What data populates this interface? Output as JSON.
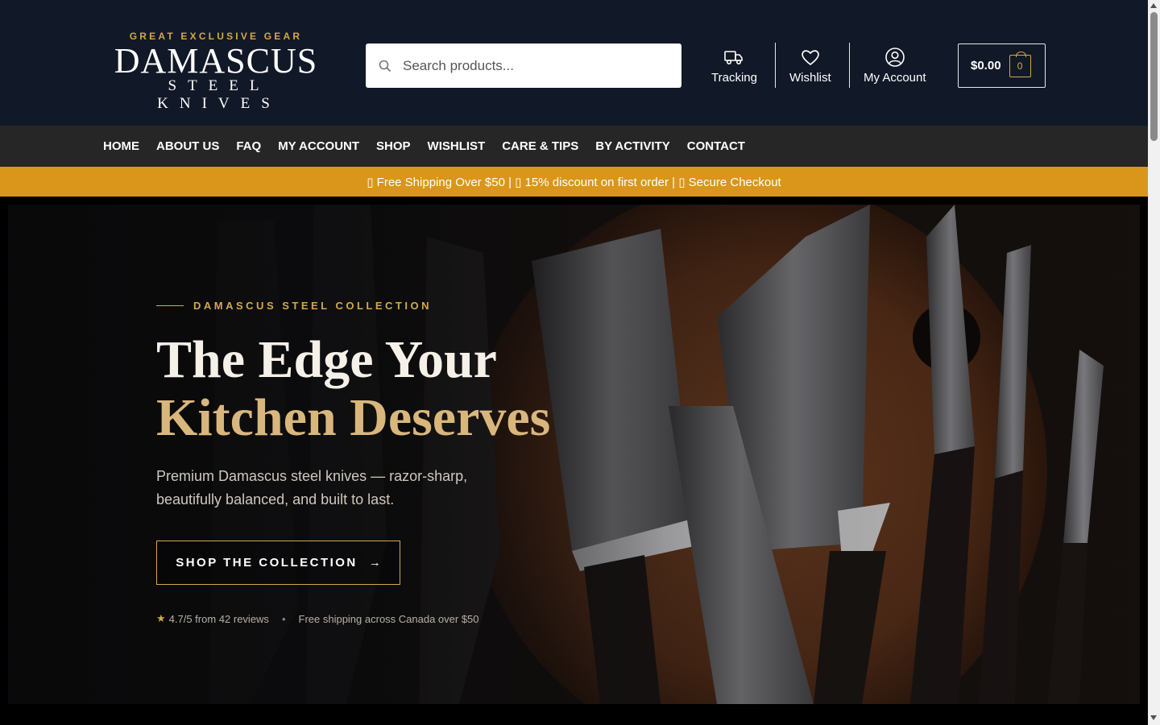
{
  "brand": {
    "tagline": "GREAT EXCLUSIVE GEAR",
    "name": "DAMASCUS",
    "subtitle": "STEEL KNIVES"
  },
  "search": {
    "placeholder": "Search products...",
    "icon": "search-icon"
  },
  "header_links": [
    {
      "label": "Tracking",
      "icon": "truck-icon"
    },
    {
      "label": "Wishlist",
      "icon": "heart-icon"
    },
    {
      "label": "My Account",
      "icon": "user-circle-icon"
    }
  ],
  "cart": {
    "total": "$0.00",
    "count": "0",
    "icon": "bag-icon"
  },
  "nav": {
    "items": [
      "HOME",
      "ABOUT US",
      "FAQ",
      "MY ACCOUNT",
      "SHOP",
      "WISHLIST",
      "CARE & TIPS",
      "BY ACTIVITY",
      "CONTACT"
    ]
  },
  "promo": {
    "text": "▯ Free Shipping Over $50 | ▯ 15% discount on first order | ▯ Secure Checkout"
  },
  "hero": {
    "eyebrow": "DAMASCUS STEEL COLLECTION",
    "title_line1": "The Edge Your",
    "title_line2": "Kitchen Deserves",
    "description": "Premium Damascus steel knives — razor-sharp, beautifully balanced, and built to last.",
    "cta_label": "SHOP THE COLLECTION",
    "cta_arrow": "→",
    "rating_star": "★",
    "rating": "4.7/5 from 42 reviews",
    "separator": "•",
    "shipping_note": "Free shipping across Canada over $50"
  },
  "colors": {
    "header_bg": "#111827",
    "nav_bg": "#262626",
    "promo_bg": "#d9961a",
    "accent_gold": "#d4a84a"
  }
}
